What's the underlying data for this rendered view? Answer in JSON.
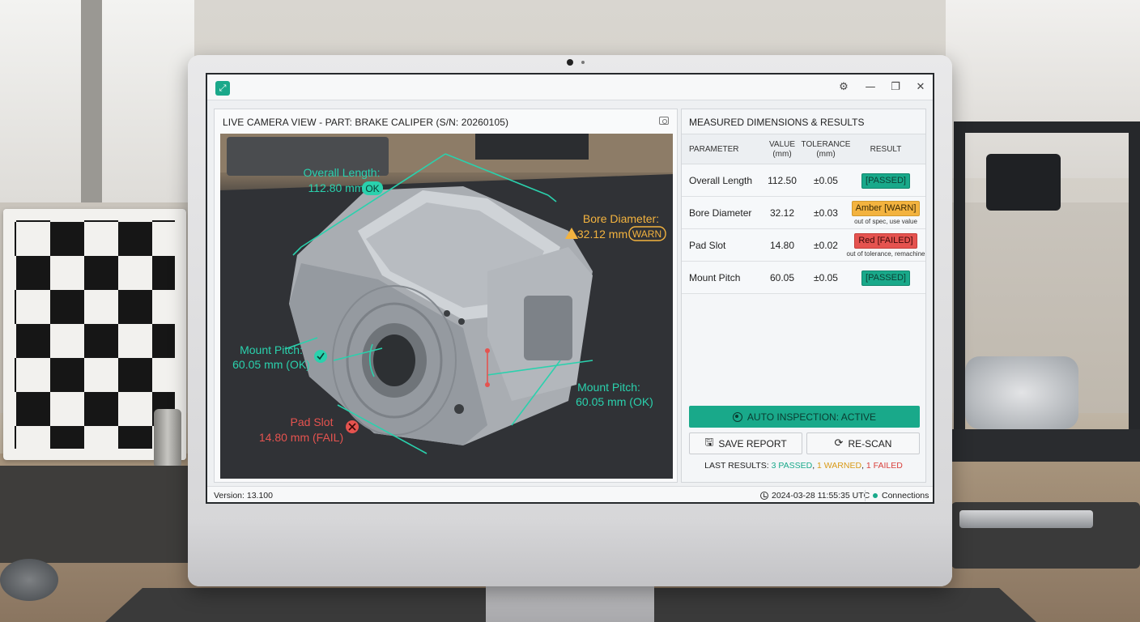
{
  "app": {
    "logo_glyph": "⤢",
    "window_controls": {
      "settings": "⚙",
      "minimize": "—",
      "maximize": "❐",
      "close": "✕"
    }
  },
  "camera_panel": {
    "title": "LIVE CAMERA VIEW - PART: BRAKE CALIPER (S/N: 20260105)",
    "overlays": {
      "overall_length": {
        "line1": "Overall Length:",
        "line2": "112.80 mm",
        "badge": "OK"
      },
      "bore_diameter": {
        "line1": "Bore Diameter:",
        "line2": "32.12 mm",
        "badge": "WARN"
      },
      "mount_pitch_left": {
        "line1": "Mount Pitch:",
        "line2": "60.05 mm (OK)"
      },
      "mount_pitch_right": {
        "line1": "Mount Pitch:",
        "line2": "60.05 mm (OK)"
      },
      "pad_slot": {
        "line1": "Pad Slot",
        "line2": "14.80 mm (FAIL)"
      }
    }
  },
  "results_panel": {
    "title": "MEASURED DIMENSIONS & RESULTS",
    "headers": {
      "parameter": "PARAMETER",
      "value": "VALUE",
      "value_unit": "(mm)",
      "tolerance": "TOLERANCE",
      "tolerance_unit": "(mm)",
      "result": "RESULT"
    },
    "rows": [
      {
        "name": "Overall Length",
        "value": "112.50",
        "tolerance": "±0.05",
        "result": "[PASSED]",
        "note": "",
        "status": "pass"
      },
      {
        "name": "Bore Diameter",
        "value": "32.12",
        "tolerance": "±0.03",
        "result": "Amber [WARN]",
        "note": "out of spec, use value",
        "status": "warn"
      },
      {
        "name": "Pad Slot",
        "value": "14.80",
        "tolerance": "±0.02",
        "result": "Red [FAILED]",
        "note": "out of tolerance, remachine",
        "status": "fail"
      },
      {
        "name": "Mount Pitch",
        "value": "60.05",
        "tolerance": "±0.05",
        "result": "[PASSED]",
        "note": "",
        "status": "pass"
      }
    ],
    "auto_inspection_label": "AUTO INSPECTION: ACTIVE",
    "save_report_label": "SAVE REPORT",
    "rescan_label": "RE-SCAN",
    "last_results": {
      "prefix": "LAST RESULTS:",
      "passed": "3 PASSED",
      "warned": "1 WARNED",
      "failed": "1 FAILED"
    }
  },
  "status_bar": {
    "version": "Version: 13.100",
    "timestamp": "2024-03-28 11:55:35 UTC",
    "connection": "Connections"
  },
  "colors": {
    "accent": "#19a98a",
    "warn": "#f3b33f",
    "fail": "#e5534f"
  }
}
